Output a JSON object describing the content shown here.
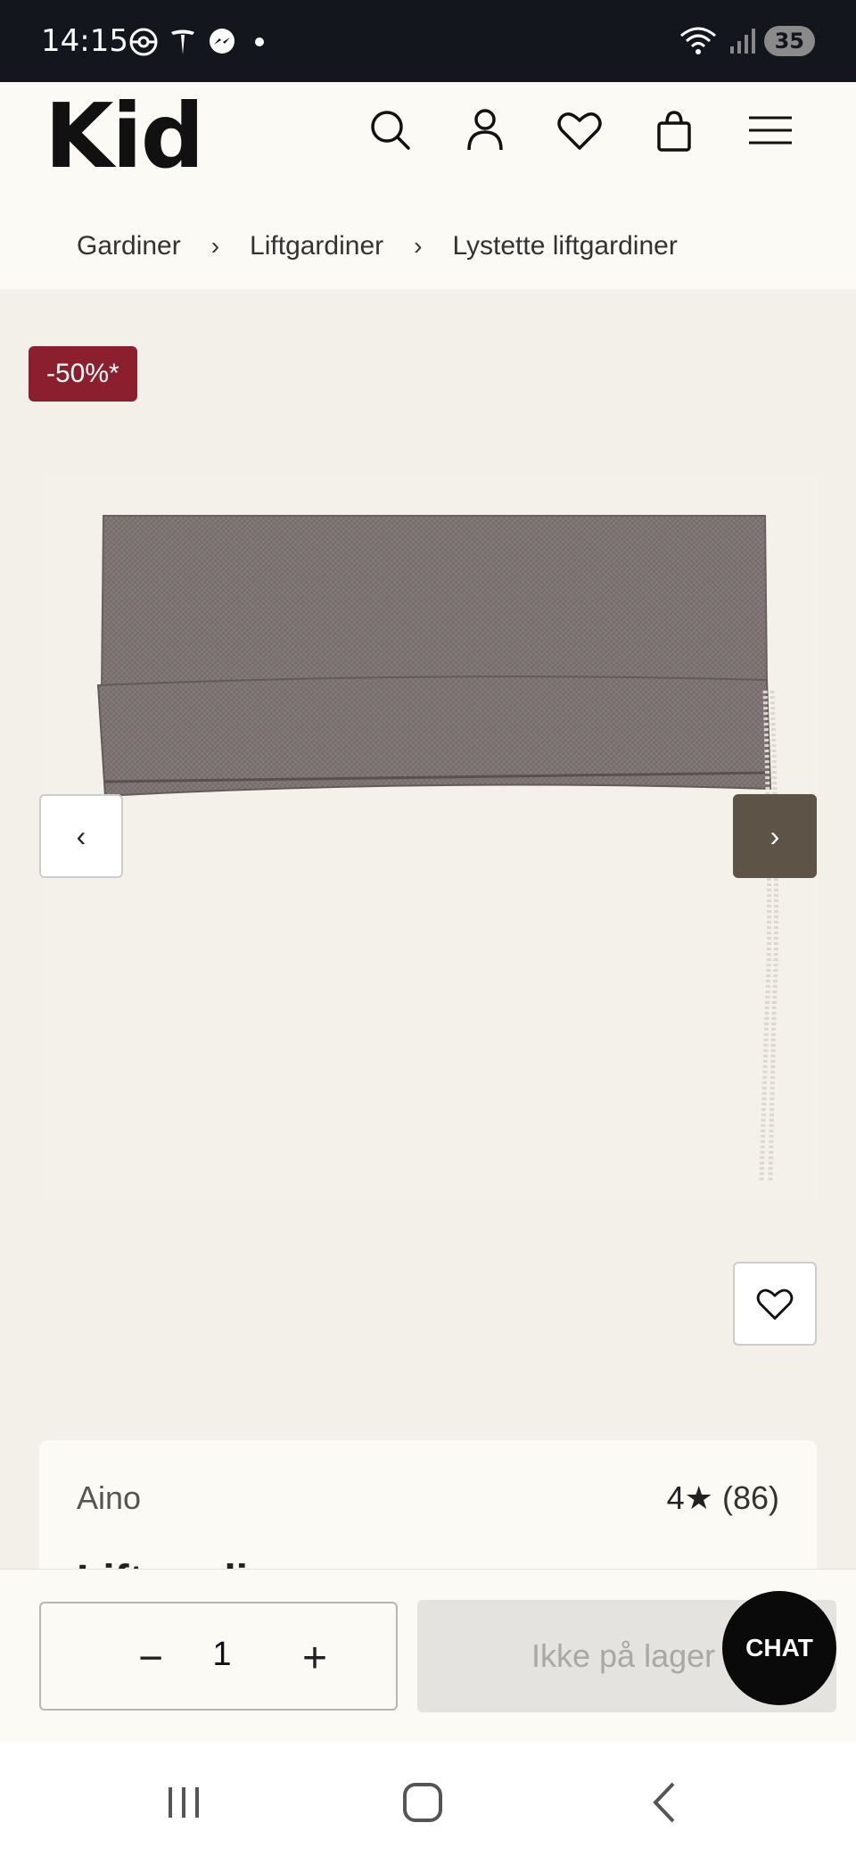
{
  "status": {
    "time": "14:15",
    "battery": "35",
    "icons": [
      "pokeball-icon",
      "tesla-icon",
      "messenger-icon",
      "dot-icon",
      "wifi-icon",
      "signal-icon"
    ]
  },
  "header": {
    "logo": "Kid",
    "icons": [
      "search-icon",
      "user-icon",
      "heart-icon",
      "bag-icon",
      "menu-icon"
    ]
  },
  "breadcrumb": {
    "items": [
      "Gardiner",
      "Liftgardiner",
      "Lystette liftgardiner"
    ],
    "separator": "›"
  },
  "product": {
    "badge": "-50%*",
    "brand": "Aino",
    "rating_value": "4",
    "rating_star": "★",
    "rating_count": "(86)",
    "title": "Liftgardin",
    "colors": {
      "badge": "#8c1f2d",
      "next_arrow": "#5d5346",
      "fabric": "#7a7070"
    }
  },
  "gallery": {
    "prev_label": "‹",
    "next_label": "›"
  },
  "buy": {
    "minus": "−",
    "quantity": "1",
    "plus": "+",
    "cart_label": "Ikke på lager",
    "chat_label": "CHAT"
  }
}
